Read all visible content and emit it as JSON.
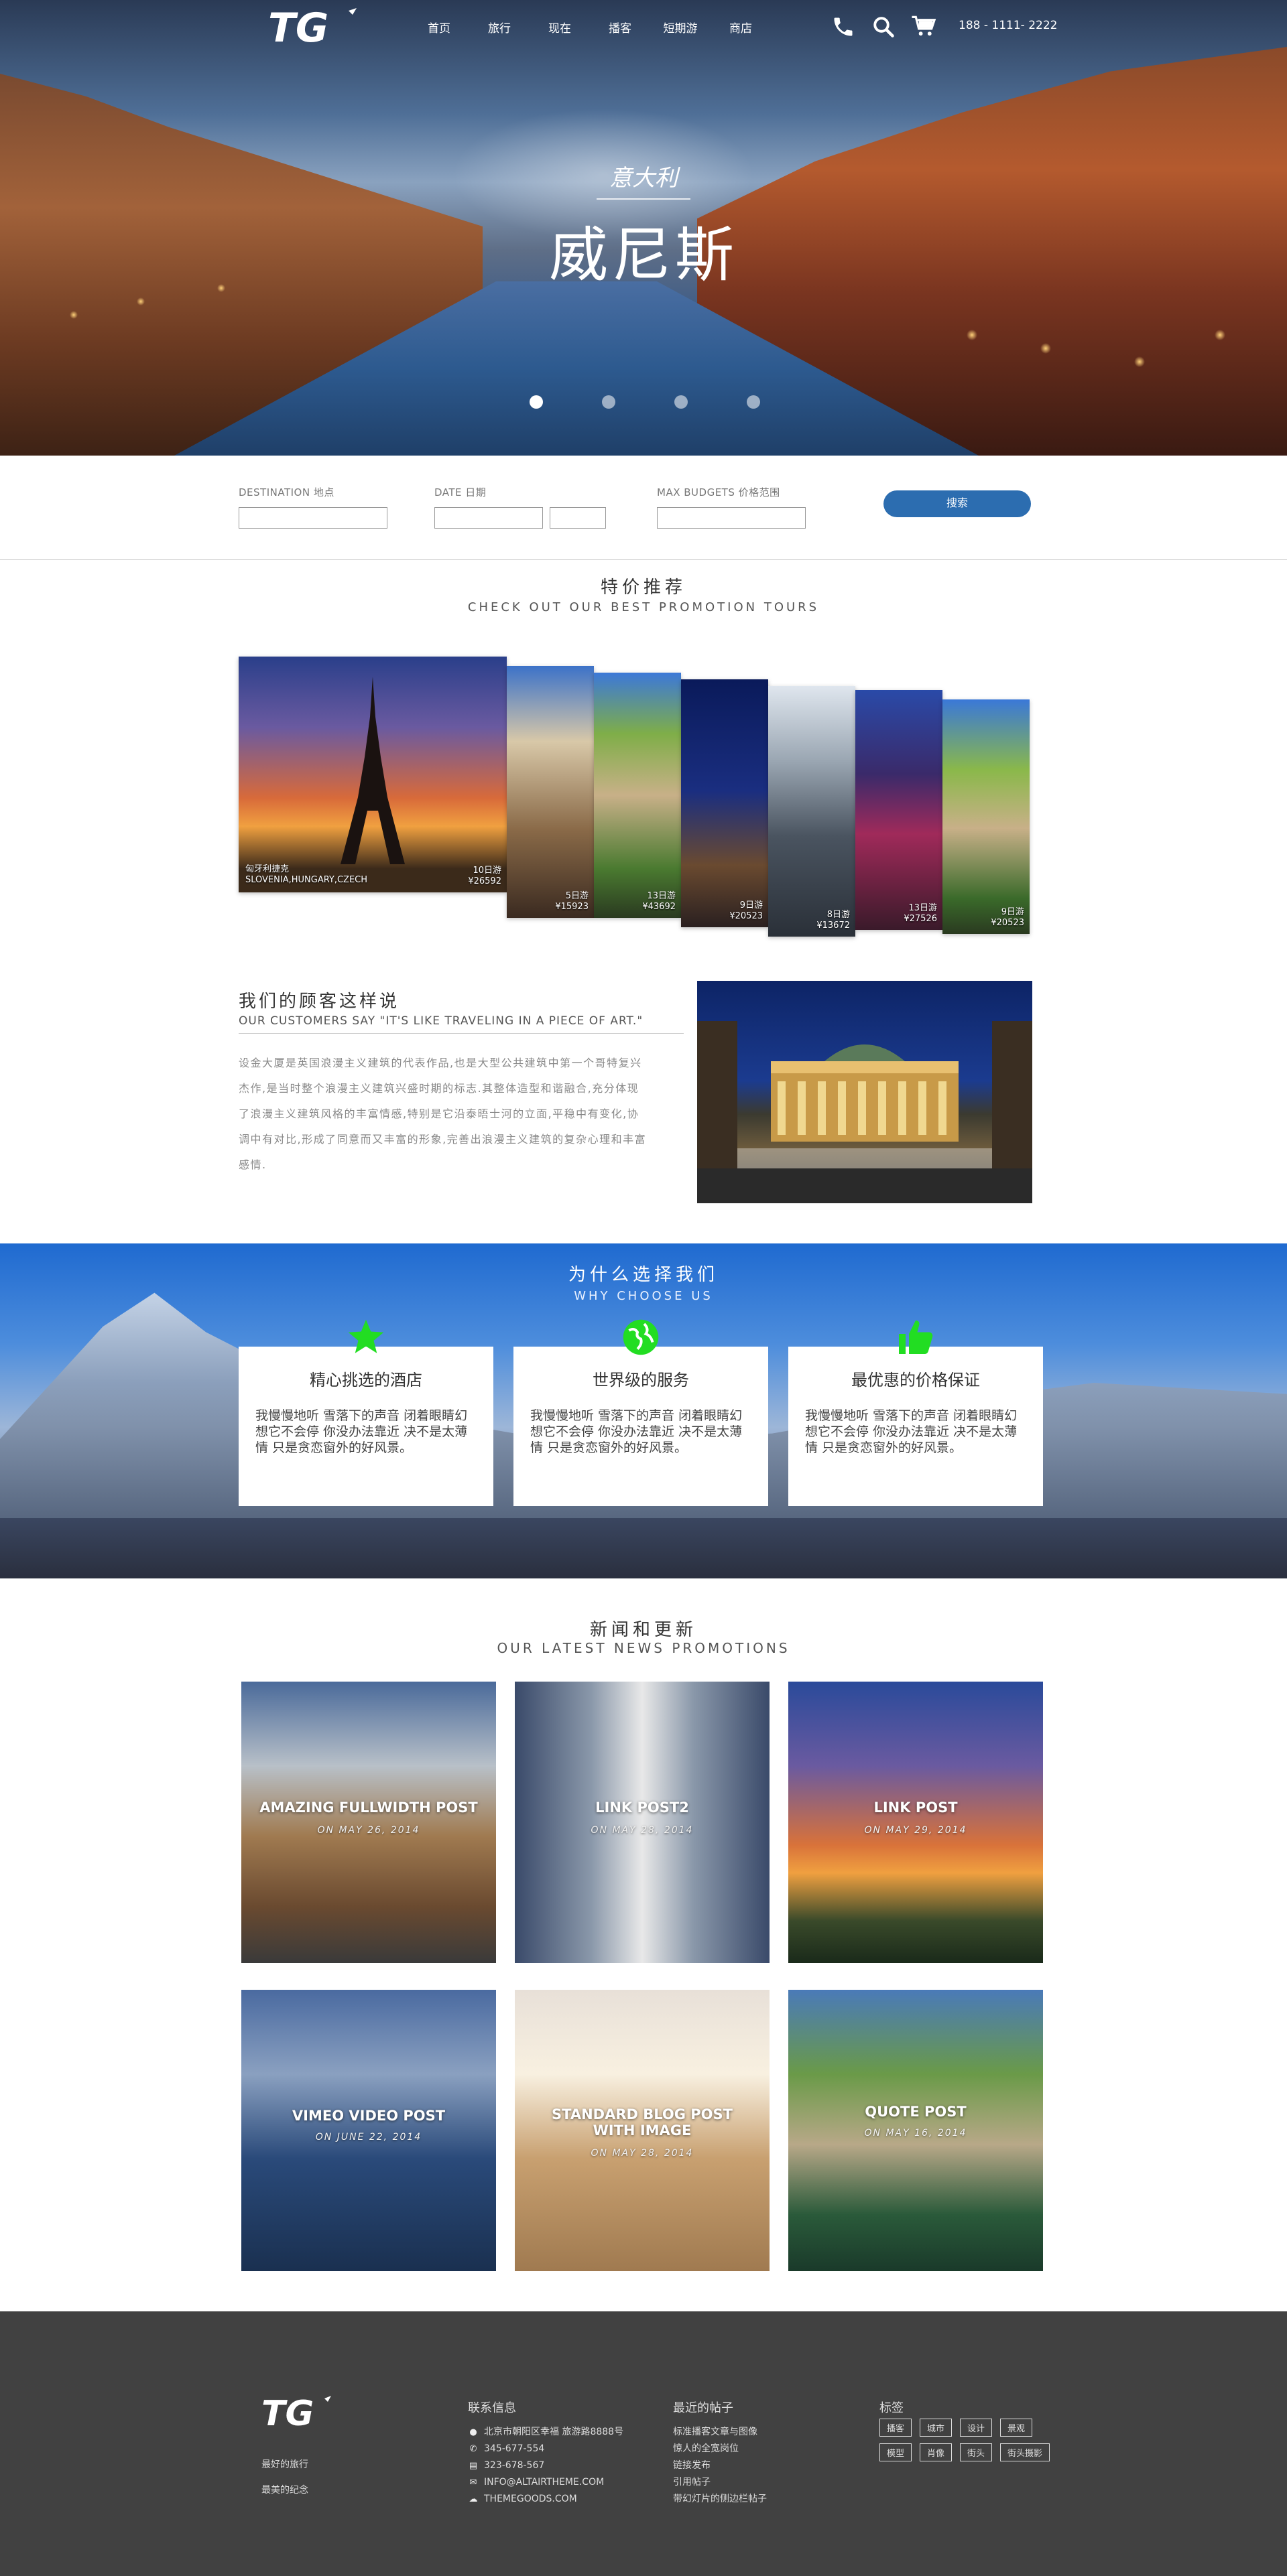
{
  "nav": {
    "logo_text": "TG",
    "menu": [
      "首页",
      "旅行",
      "现在",
      "播客",
      "短期游",
      "商店"
    ],
    "icons": [
      "phone-icon",
      "search-icon",
      "cart-icon"
    ],
    "phone": "188 - 1111- 2222"
  },
  "hero": {
    "subtitle": "意大利",
    "title": "威尼斯",
    "slides": 4,
    "active_slide": 1
  },
  "search": {
    "destination_label": "DESTINATION 地点",
    "date_label": "DATE 日期",
    "budget_label": "MAX BUDGETS 价格范围",
    "button": "搜索"
  },
  "promo": {
    "title": "特价推荐",
    "subtitle": "CHECK OUT OUR BEST PROMOTION TOURS",
    "featured_location_1": "匈牙利捷克",
    "featured_location_2": "SLOVENIA,HUNGARY,CZECH",
    "cards": [
      {
        "days": "10日游",
        "price": "¥26592"
      },
      {
        "days": "5日游",
        "price": "¥15923"
      },
      {
        "days": "13日游",
        "price": "¥43692"
      },
      {
        "days": "9日游",
        "price": "¥20523"
      },
      {
        "days": "8日游",
        "price": "¥13672"
      },
      {
        "days": "13日游",
        "price": "¥27526"
      },
      {
        "days": "9日游",
        "price": "¥20523"
      }
    ]
  },
  "testimonial": {
    "title": "我们的顾客这样说",
    "subtitle": "OUR CUSTOMERS SAY \"IT'S LIKE TRAVELING IN A PIECE OF ART.\"",
    "body": "设金大厦是英国浪漫主义建筑的代表作品,也是大型公共建筑中第一个哥特复兴杰作,是当时整个浪漫主义建筑兴盛时期的标志.其整体造型和谐融合,充分体现了浪漫主义建筑风格的丰富情感,特别是它沿泰晤士河的立面,平稳中有变化,协调中有对比,形成了同意而又丰富的形象,完善出浪漫主义建筑的复杂心理和丰富感情."
  },
  "why": {
    "title": "为什么选择我们",
    "subtitle": "WHY CHOOSE US",
    "cards": [
      {
        "title": "精心挑选的酒店",
        "text": "我慢慢地听 雪落下的声音 闭着眼睛幻想它不会停 你没办法靠近 决不是太薄情 只是贪恋窗外的好风景。",
        "icon": "star-icon"
      },
      {
        "title": "世界级的服务",
        "text": "我慢慢地听 雪落下的声音 闭着眼睛幻想它不会停 你没办法靠近 决不是太薄情 只是贪恋窗外的好风景。",
        "icon": "globe-icon"
      },
      {
        "title": "最优惠的价格保证",
        "text": "我慢慢地听 雪落下的声音 闭着眼睛幻想它不会停 你没办法靠近 决不是太薄情 只是贪恋窗外的好风景。",
        "icon": "thumbs-up-icon"
      }
    ],
    "icon_color": "#22dd22"
  },
  "news": {
    "title": "新闻和更新",
    "subtitle": "OUR  LATEST NEWS  PROMOTIONS",
    "posts": [
      {
        "title": "AMAZING FULLWIDTH POST",
        "date": "ON MAY 26, 2014"
      },
      {
        "title": "LINK POST2",
        "date": "ON MAY 28, 2014"
      },
      {
        "title": "LINK POST",
        "date": "ON MAY 29, 2014"
      },
      {
        "title": "VIMEO VIDEO POST",
        "date": "ON JUNE 22, 2014"
      },
      {
        "title": "STANDARD BLOG POST WITH IMAGE",
        "date": "ON MAY 28, 2014"
      },
      {
        "title": "QUOTE POST",
        "date": "ON MAY 16, 2014"
      }
    ]
  },
  "footer": {
    "slogans": [
      "最好的旅行",
      "最美的纪念"
    ],
    "contact_title": "联系信息",
    "contact": [
      {
        "icon": "location-icon",
        "text": "北京市朝阳区幸福 旅游路8888号"
      },
      {
        "icon": "phone-icon",
        "text": "345-677-554"
      },
      {
        "icon": "fax-icon",
        "text": "323-678-567"
      },
      {
        "icon": "mail-icon",
        "text": "INFO@ALTAIRTHEME.COM"
      },
      {
        "icon": "chat-icon",
        "text": "THEMEGOODS.COM"
      }
    ],
    "recent_title": "最近的帖子",
    "recent": [
      "标准播客文章与图像",
      "惊人的全宽岗位",
      "链接发布",
      "引用帖子",
      "带幻灯片的侧边栏帖子"
    ],
    "tags_title": "标签",
    "tags": [
      "播客",
      "城市",
      "设计",
      "景观",
      "模型",
      "肖像",
      "街头",
      "街头摄影"
    ]
  }
}
